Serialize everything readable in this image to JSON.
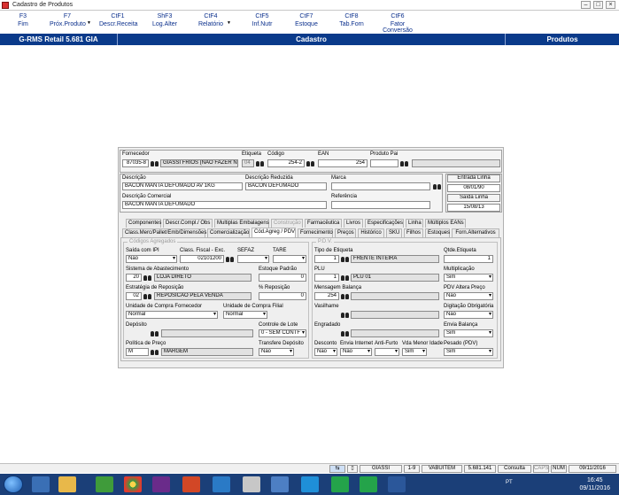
{
  "window": {
    "title": "Cadastro de Produtos"
  },
  "fkeys": [
    {
      "key": "F3",
      "label": "Fim"
    },
    {
      "key": "F7",
      "label": "Próx.Produto"
    },
    {
      "key": "CtF1",
      "label": "Descr.Receita"
    },
    {
      "key": "ShF3",
      "label": "Log.Alter"
    },
    {
      "key": "CtF4",
      "label": "Relatório"
    },
    {
      "key": "CtF5",
      "label": "Inf.Nutr"
    },
    {
      "key": "CtF7",
      "label": "Estoque"
    },
    {
      "key": "CtF8",
      "label": "Tab.Forn"
    },
    {
      "key": "CtF6",
      "label": "Fator Conversão"
    }
  ],
  "header": {
    "app": "G-RMS Retail 5.681 GIA",
    "section": "Cadastro",
    "right": "Produtos"
  },
  "form": {
    "fornecedor": {
      "label": "Fornecedor",
      "code": "87035-8",
      "name": "GIASSI FRIOS (NAO FAZER N.F.)"
    },
    "etiqueta": {
      "label": "Etiqueta",
      "value": "04"
    },
    "codigo": {
      "label": "Código",
      "value": "254-2"
    },
    "ean": {
      "label": "EAN",
      "value": "254"
    },
    "produto_pai": {
      "label": "Produto Pai",
      "value": ""
    },
    "descricao": {
      "label": "Descrição",
      "value": "BACON MANTA DEFUMADO          AV  1KG"
    },
    "descricao_reduzida": {
      "label": "Descrição Reduzida",
      "value": "BACON DEFUMADO"
    },
    "marca": {
      "label": "Marca",
      "value": ""
    },
    "descricao_comercial": {
      "label": "Descrição Comercial",
      "value": "BACON MANTA DEFUMADO"
    },
    "referencia": {
      "label": "Referência",
      "value": ""
    },
    "entrada_linha": {
      "label": "Entrada Linha",
      "value": "08/01/90"
    },
    "saida_linha": {
      "label": "Saída Linha",
      "value": "15/08/13"
    }
  },
  "tabs_row1": [
    "Componentes",
    "Descr.Compl./ Obs",
    "Multiplas Embalagens",
    "Construção",
    "Farmacêutica",
    "Livros",
    "Especificações",
    "Linha",
    "Múltiplos EANs"
  ],
  "tabs_row2": [
    "Class.Merc/Pallet/Emb/Dimensões",
    "Comercialização",
    "Cód.Agreg / PDV",
    "Fornecimento",
    "Preços",
    "Histórico",
    "SKU",
    "Filhos",
    "Estoques",
    "Forn.Alternativos"
  ],
  "codigos_agregados": {
    "title": "Códigos Agregados",
    "saida_com_ipi": {
      "label": "Saída com IPI",
      "value": "Não"
    },
    "class_fiscal": {
      "label": "Class. Fiscal - Exc.",
      "value": "02101200"
    },
    "sefaz": {
      "label": "SEFAZ",
      "value": ""
    },
    "tare": {
      "label": "TARE",
      "value": ""
    },
    "sistema_abastecimento": {
      "label": "Sistema de Abastecimento",
      "code": "20",
      "name": "LOJA DIRETO"
    },
    "estoque_padrao": {
      "label": "Estoque Padrão",
      "value": "0"
    },
    "estrategia_reposicao": {
      "label": "Estratégia de Reposição",
      "code": "02",
      "name": "REPOSICAO PELA VENDA"
    },
    "perc_reposicao": {
      "label": "% Reposição",
      "value": "0"
    },
    "unidade_compra_fornecedor": {
      "label": "Unidade de Compra Fornecedor",
      "value": "Normal"
    },
    "unidade_compra_filial": {
      "label": "Unidade de Compra Filial",
      "value": "Normal"
    },
    "deposito": {
      "label": "Depósito",
      "value": ""
    },
    "controle_lote": {
      "label": "Controle de Lote",
      "value": "0 - SEM CONTF"
    },
    "politica_preco": {
      "label": "Política de Preço",
      "code": "M",
      "name": "MARGEM"
    },
    "transfere_deposito": {
      "label": "Transfere Depósito",
      "value": "Não"
    }
  },
  "pdv": {
    "title": "P.D.V.",
    "tipo_etiqueta": {
      "label": "Tipo de Etiqueta",
      "code": "1",
      "name": "FRENTE INTEIRA"
    },
    "qtde_etiqueta": {
      "label": "Qtde.Etiqueta",
      "value": "1"
    },
    "plu": {
      "label": "PLU",
      "code": "1",
      "name": "PLU 01"
    },
    "multiplicacao": {
      "label": "Multiplicação",
      "value": "Sim"
    },
    "mensagem_balanca": {
      "label": "Mensagem Balança",
      "code": "254",
      "name": ""
    },
    "pdv_altera_preco": {
      "label": "PDV Altera Preço",
      "value": "Não"
    },
    "vasilhame": {
      "label": "Vasilhame",
      "value": ""
    },
    "digitacao_obrigatoria": {
      "label": "Digitação Obrigatória",
      "value": "Não"
    },
    "engradado": {
      "label": "Engradado",
      "value": ""
    },
    "envia_balanca": {
      "label": "Envia Balança",
      "value": "Sim"
    },
    "desconto": {
      "label": "Desconto",
      "value": "Não"
    },
    "envia_internet": {
      "label": "Envia Internet",
      "value": "Não"
    },
    "anti_furto": {
      "label": "Anti-Furto",
      "value": ""
    },
    "vda_menor_idade": {
      "label": "Vda Menor Idade",
      "value": "Sim"
    },
    "pesado_pdv": {
      "label": "Pesado (PDV)",
      "value": "Sim"
    }
  },
  "status": {
    "user": "GIASSI",
    "range": "1-9",
    "code": "VABUITEM",
    "version": "5.681.141",
    "mode": "Consulta",
    "caps": "CAPS",
    "num": "NUM",
    "date": "09/11/2016"
  },
  "taskbar": {
    "lang": "PT",
    "time": "16:45",
    "date": "09/11/2016"
  },
  "colors": {
    "header_blue": "#0a3a8a",
    "fkey_blue": "#0a2f8c",
    "taskbar": "#1b3f78"
  }
}
